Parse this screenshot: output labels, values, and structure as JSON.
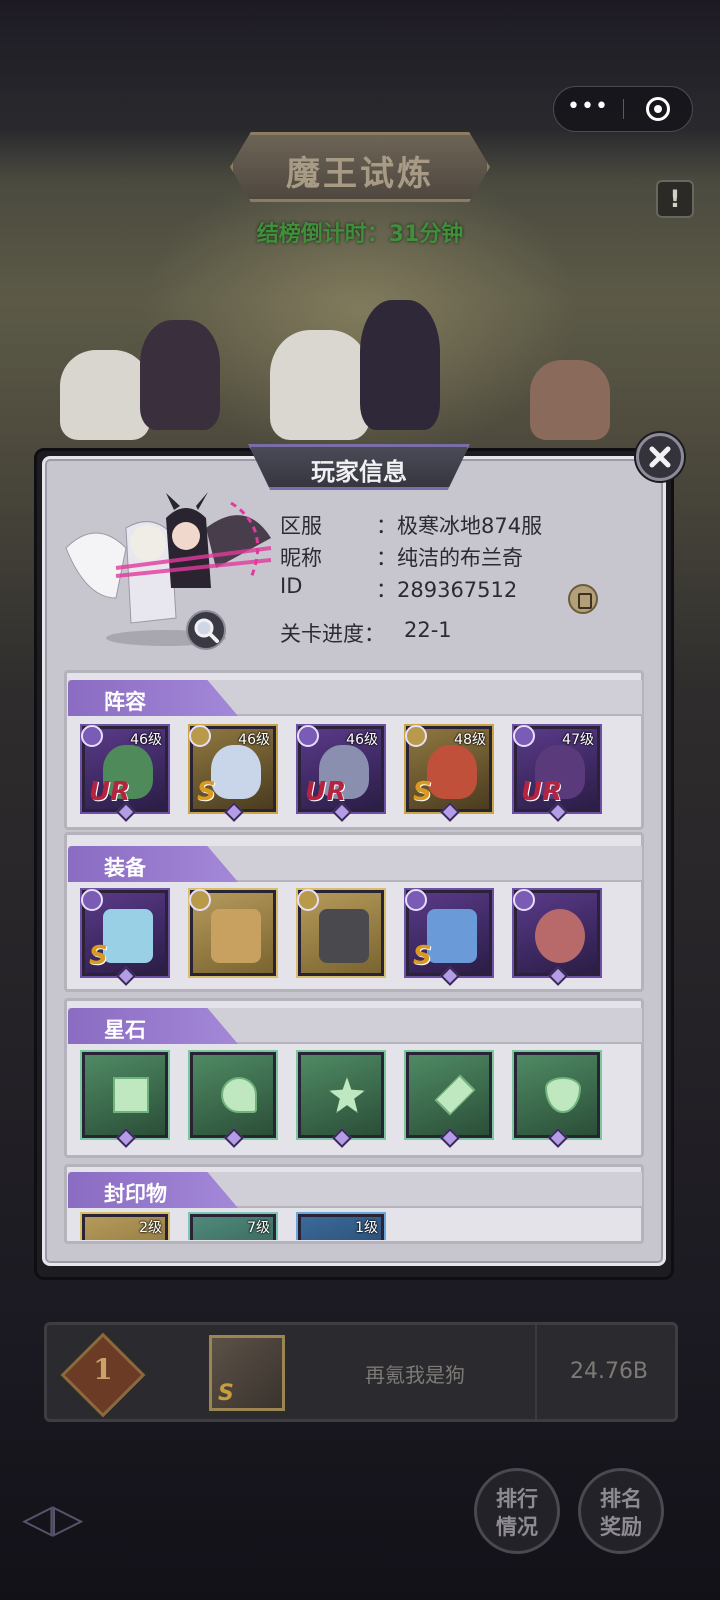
{
  "mini_program": {
    "more_icon": "more-dots-icon",
    "close_icon": "target-icon"
  },
  "event": {
    "title": "魔王试炼",
    "countdown": "结榜倒计时：31分钟"
  },
  "ranking": {
    "rank": "1",
    "player_name": "再氪我是狗",
    "score": "24.76B",
    "avatar_rarity": "S",
    "buttons": {
      "ranking_status": "排行\n情况",
      "rank_rewards": "排名\n奖励"
    }
  },
  "modal": {
    "title": "玩家信息",
    "profile": {
      "server_label": "区服",
      "server_value": "：极寒冰地874服",
      "nickname_label": "昵称",
      "nickname_value": "：纯洁的布兰奇",
      "id_label": "ID",
      "id_value": "：289367512",
      "progress_label": "关卡进度：",
      "progress_value": "22-1"
    },
    "sections": {
      "lineup": "阵容",
      "equipment": "装备",
      "starstone": "星石",
      "seal": "封印物"
    },
    "lineup": [
      {
        "level": "46级",
        "rarity": "UR",
        "face": "#4f8a5a"
      },
      {
        "level": "46级",
        "rarity": "S",
        "face": "#c9d6ea"
      },
      {
        "level": "46级",
        "rarity": "UR",
        "face": "#8a8fb0"
      },
      {
        "level": "48级",
        "rarity": "S",
        "face": "#c0503a"
      },
      {
        "level": "47级",
        "rarity": "UR",
        "face": "#5a3a7a"
      }
    ],
    "equipment": [
      {
        "name": "trident-icon",
        "rarity": "S"
      },
      {
        "name": "book-icon",
        "rarity": ""
      },
      {
        "name": "wizard-hat-icon",
        "rarity": ""
      },
      {
        "name": "cape-icon",
        "rarity": "S"
      },
      {
        "name": "ring-icon",
        "rarity": ""
      }
    ],
    "starstones": [
      "square-gem-icon",
      "heart-gem-icon",
      "star-gem-icon",
      "crystal-gem-icon",
      "shield-gem-icon"
    ],
    "seals": [
      {
        "level": "2级"
      },
      {
        "level": "7级"
      },
      {
        "level": "1级"
      }
    ]
  },
  "colors": {
    "countdown": "#3f8f3b",
    "section_tab": "#8a6cc2",
    "modal_bg": "#c7c6cf"
  }
}
